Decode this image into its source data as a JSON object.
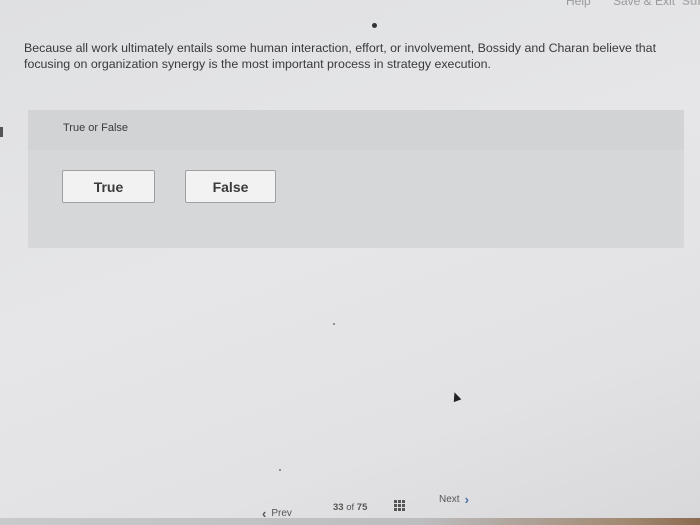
{
  "header": {
    "help_label": "Help",
    "save_exit_label": "Save & Exit",
    "submit_label": "Sub"
  },
  "question": {
    "text": "Because all work ultimately entails some human interaction, effort, or involvement, Bossidy and Charan believe that focusing on organization synergy is the most important process in strategy execution."
  },
  "answer_panel": {
    "type_label": "True or False",
    "options": [
      {
        "label": "True"
      },
      {
        "label": "False"
      }
    ]
  },
  "navigation": {
    "prev_label": "Prev",
    "current_page": "33",
    "of_label": "of",
    "total_pages": "75",
    "next_label": "Next"
  },
  "icons": {
    "prev": "chevron-left-icon",
    "next": "chevron-right-icon",
    "grid": "grid-icon"
  }
}
